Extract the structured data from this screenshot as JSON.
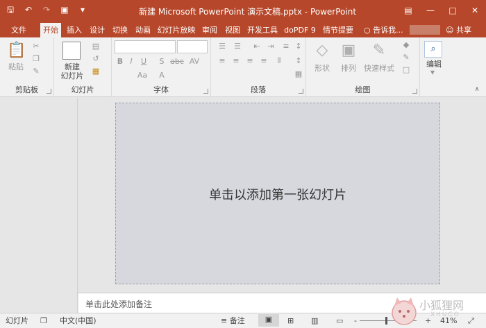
{
  "window": {
    "title": "新建 Microsoft PowerPoint 演示文稿.pptx - PowerPoint"
  },
  "qat": {
    "save_icon": "save-icon",
    "undo_icon": "undo-icon",
    "redo_icon": "redo-icon",
    "present_icon": "slideshow-icon",
    "customize_icon": "customize-icon"
  },
  "tabs": [
    {
      "label": "文件"
    },
    {
      "label": "开始"
    },
    {
      "label": "插入"
    },
    {
      "label": "设计"
    },
    {
      "label": "切换"
    },
    {
      "label": "动画"
    },
    {
      "label": "幻灯片放映"
    },
    {
      "label": "审阅"
    },
    {
      "label": "视图"
    },
    {
      "label": "开发工具"
    },
    {
      "label": "doPDF 9"
    },
    {
      "label": "情节提要"
    }
  ],
  "tell_me": "告诉我...",
  "share": "共享",
  "ribbon": {
    "clipboard": {
      "label": "剪贴板",
      "paste": "粘贴"
    },
    "slides": {
      "label": "幻灯片",
      "new_slide_line1": "新建",
      "new_slide_line2": "幻灯片"
    },
    "font": {
      "label": "字体",
      "bold": "B",
      "italic": "I",
      "underline": "U",
      "shadow": "S",
      "strike": "abc",
      "spacing": "AV",
      "case": "Aa",
      "color": "A"
    },
    "paragraph": {
      "label": "段落"
    },
    "drawing": {
      "label": "绘图",
      "shapes": "形状",
      "arrange": "排列",
      "quick_styles": "快速样式"
    },
    "editing": {
      "label": "编辑"
    }
  },
  "slide": {
    "title_placeholder": "单击以添加第一张幻灯片"
  },
  "notes": {
    "placeholder": "单击此处添加备注"
  },
  "status": {
    "slide_label": "幻灯片",
    "language": "中文(中国)",
    "notes_button": "备注",
    "zoom_minus": "-",
    "zoom_plus": "+",
    "zoom_level": "41%"
  },
  "watermark": {
    "text": "小狐狸网",
    "sub": "XHUCO"
  },
  "colors": {
    "accent": "#b7472a"
  }
}
